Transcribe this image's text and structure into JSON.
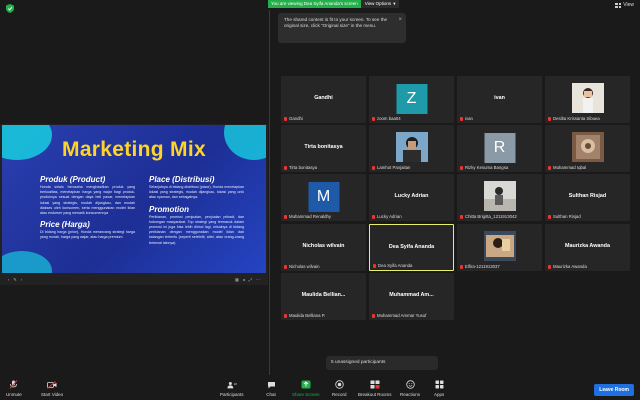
{
  "top_bar": {
    "banner_text": "You are viewing Dea Syifa Ananda's screen",
    "view_options_label": "View Options",
    "view_label": "View"
  },
  "tooltip": {
    "text": "The shared content is fit to your screen. To see the original size, click \"Original size\" in the menu."
  },
  "slide": {
    "title": "Marketing Mix",
    "sections": [
      {
        "heading": "Produk (Product)",
        "body": "Honda selalu berusaha menghasilkan produk yang berkualitas, menetapkan harga yang wajar bagi produk-produknya sesuai dengan daya beli pasar, menetapkan lokasi yang strategis, mudah dijangkau, dan mudah diakses oleh konsumen, serta menggunakan model iklan atau endorser yang menarik konsumennya"
      },
      {
        "heading": "Price (Harga)",
        "body": "Di bidang harga (price), Honda merancang strategi harga yang murah, harga yang wajar, atau harga premium"
      },
      {
        "heading": "Place (Distribusi)",
        "body": "Selanjutnya di bidang distribusi (place), Honda menetapkan lokasi yang strategis, mudah dijangkau, lokasi yang unik atau nyaman, dan sebagainya."
      },
      {
        "heading": "Promotion",
        "body": "Periklanan, promosi penjualan, penjualan pribadi, dan hubungan masyarakat. Top strategi yang termasuk dalam promosi ini juga bisa lebih dirinci lagi, misalnya di bidang periklanan dengan menggunakan model iklan dari kalangan tertentu (seperti selebriti, atlet, atau orang-orang terkenal lainnya)."
      }
    ]
  },
  "participants": [
    {
      "name": "Gandhi",
      "label": "Gandhi",
      "kind": "name"
    },
    {
      "name": "",
      "label": "zoom baa04",
      "kind": "letter",
      "letter": "Z",
      "color": "#1e9aa8"
    },
    {
      "name": "ivan",
      "label": "ivan",
      "kind": "name"
    },
    {
      "name": "",
      "label": "Desilta Krissanta Sibuea",
      "kind": "photo"
    },
    {
      "name": "Tirta bonitasya",
      "label": "Tirta bonitasya",
      "kind": "name"
    },
    {
      "name": "",
      "label": "Lamhot Panjaitan",
      "kind": "photo"
    },
    {
      "name": "",
      "label": "Rizky Kesuma Bangsa",
      "kind": "letter",
      "letter": "R",
      "color": "#8a9aa6"
    },
    {
      "name": "",
      "label": "Muhammad Iqbal",
      "kind": "photo"
    },
    {
      "name": "",
      "label": "Muhammad Renaldhy",
      "kind": "letter",
      "letter": "M",
      "color": "#1e5aa8"
    },
    {
      "name": "Lucky Adrian",
      "label": "Lucky Adrian",
      "kind": "name"
    },
    {
      "name": "",
      "label": "Chitta Brigitta_1211913042",
      "kind": "photo"
    },
    {
      "name": "Sulthan Risjad",
      "label": "Sulthan Risjad",
      "kind": "name"
    },
    {
      "name": "Nicholas wilvain",
      "label": "Nicholas wilvain",
      "kind": "name"
    },
    {
      "name": "Dea Syifa Ananda",
      "label": "Dea Syifa Ananda",
      "kind": "name",
      "active": true
    },
    {
      "name": "",
      "label": "Elfira-1211913037",
      "kind": "photo"
    },
    {
      "name": "Maurizka Awanda",
      "label": "Maurizka Awanda",
      "kind": "name"
    },
    {
      "name": "Maulida  Bellian...",
      "label": "Maulida Belliana P.",
      "kind": "name"
    },
    {
      "name": "Muhammad  Am...",
      "label": "Muhammad Ammar Yusuf",
      "kind": "name"
    }
  ],
  "unassigned_text": "5 unassigned participants",
  "toolbar": {
    "unmute": "Unmute",
    "start_video": "Start Video",
    "participants": "Participants",
    "participants_count": "18",
    "chat": "Chat",
    "share_screen": "Share Screen",
    "record": "Record",
    "breakout_rooms": "Breakout Rooms",
    "reactions": "Reactions",
    "apps": "Apps",
    "leave_room": "Leave Room"
  },
  "colors": {
    "banner_green": "#23b04a",
    "share_green": "#23b04a",
    "leave_blue": "#1f6fe0",
    "active_border": "#e8f06a",
    "muted_red": "#e33"
  }
}
